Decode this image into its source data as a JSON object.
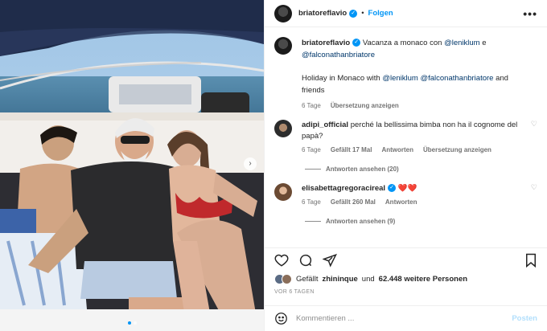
{
  "header": {
    "username": "briatoreflavio",
    "separator": "•",
    "follow_label": "Folgen",
    "more_label": "•••"
  },
  "caption": {
    "username": "briatoreflavio",
    "text_it_prefix": "Vacanza a monaco con",
    "mention_1": "@leniklum",
    "text_it_and": "e",
    "mention_2": "@falconathanbriatore",
    "text_en_prefix": "Holiday in Monaco with",
    "mention_en_1": "@leniklum",
    "mention_en_2": "@falconathanbriatore",
    "text_en_suffix": "and",
    "text_en_friends": "friends",
    "age": "6 Tage",
    "translate": "Übersetzung anzeigen"
  },
  "comments": [
    {
      "username": "adipi_official",
      "text": "perché la bellissima bimba non ha il cognome del papà?",
      "age": "6 Tage",
      "likes": "Gefällt 17 Mal",
      "reply": "Antworten",
      "translate": "Übersetzung anzeigen",
      "view_replies": "Antworten ansehen (20)"
    },
    {
      "username": "elisabettagregoracireal",
      "text": "❤️❤️",
      "age": "6 Tage",
      "likes": "Gefällt 260 Mal",
      "reply": "Antworten",
      "view_replies": "Antworten ansehen (9)"
    }
  ],
  "likes": {
    "prefix": "Gefällt",
    "user": "zhininque",
    "middle": "und",
    "count": "62.448 weitere Personen"
  },
  "date": "VOR 6 TAGEN",
  "comment_input": {
    "placeholder": "Kommentieren ...",
    "post_label": "Posten"
  },
  "carousel": {
    "dots_total": 2,
    "active_dot": 1
  },
  "colors": {
    "accent": "#0095f6",
    "mention": "#00376b",
    "muted": "#737373"
  }
}
